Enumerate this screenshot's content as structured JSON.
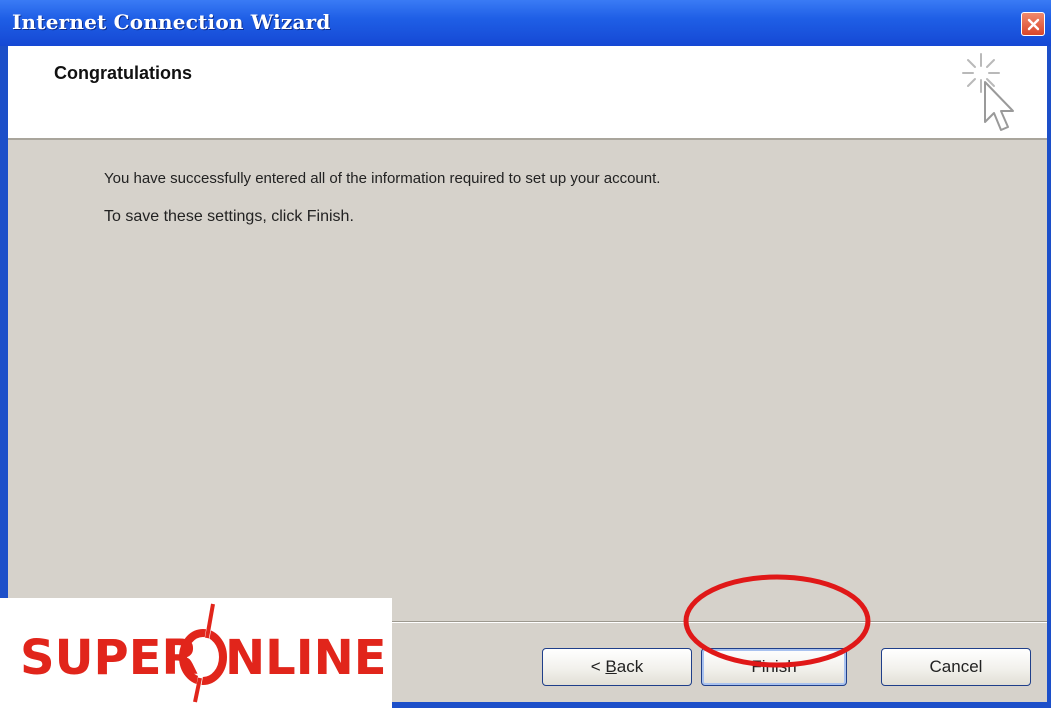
{
  "window": {
    "title": "Internet Connection Wizard"
  },
  "header": {
    "title": "Congratulations",
    "icon": "wizard-cursor-sparkle-icon"
  },
  "content": {
    "line1": "You have successfully entered all of the information required to set up your account.",
    "line2": "To save these settings, click Finish."
  },
  "buttons": {
    "back_prefix": "< ",
    "back_mnemonic": "B",
    "back_rest": "ack",
    "finish": "Finish",
    "cancel": "Cancel"
  },
  "watermark": {
    "logo_text": "SUPERONLINE"
  },
  "colors": {
    "titlebar": "#1f5fe6",
    "dialog_bg": "#d6d2cb",
    "highlight_ring": "#e01818",
    "logo_red": "#e1251b"
  }
}
